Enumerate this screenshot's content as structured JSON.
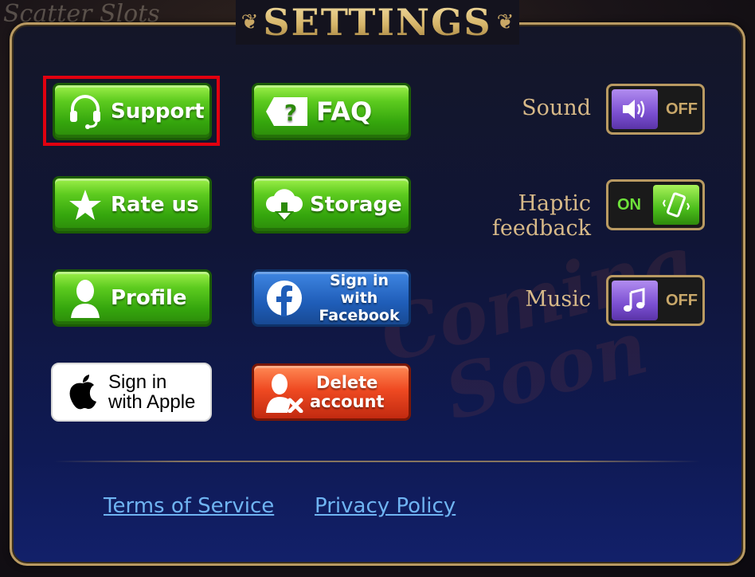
{
  "background_logo": "Scatter Slots",
  "title": "SETTINGS",
  "buttons": {
    "support": "Support",
    "faq": "FAQ",
    "rate_us": "Rate us",
    "storage": "Storage",
    "profile": "Profile",
    "facebook_line1": "Sign in with",
    "facebook_line2": "Facebook",
    "apple_line1": "Sign in",
    "apple_line2": "with Apple",
    "delete_line1": "Delete",
    "delete_line2": "account"
  },
  "settings": {
    "sound": {
      "label": "Sound",
      "state": "OFF"
    },
    "haptic": {
      "label": "Haptic feedback",
      "state": "ON"
    },
    "music": {
      "label": "Music",
      "state": "OFF"
    }
  },
  "watermark": {
    "line1": "Coming",
    "line2": "Soon"
  },
  "footer": {
    "terms": "Terms of Service",
    "privacy": "Privacy Policy"
  },
  "colors": {
    "gold": "#d7b988",
    "green_button": "#35a60d",
    "blue_button": "#1f5db8",
    "red_button": "#ef4a22",
    "link": "#6fb4f2",
    "highlight": "#e1000f"
  },
  "icons": {
    "support": "headset-icon",
    "faq": "question-tag-icon",
    "rate_us": "star-icon",
    "storage": "cloud-download-icon",
    "profile": "person-silhouette-icon",
    "facebook": "facebook-icon",
    "apple": "apple-icon",
    "delete": "person-remove-icon",
    "sound": "speaker-icon",
    "haptic": "vibrating-phone-icon",
    "music": "music-note-icon"
  }
}
